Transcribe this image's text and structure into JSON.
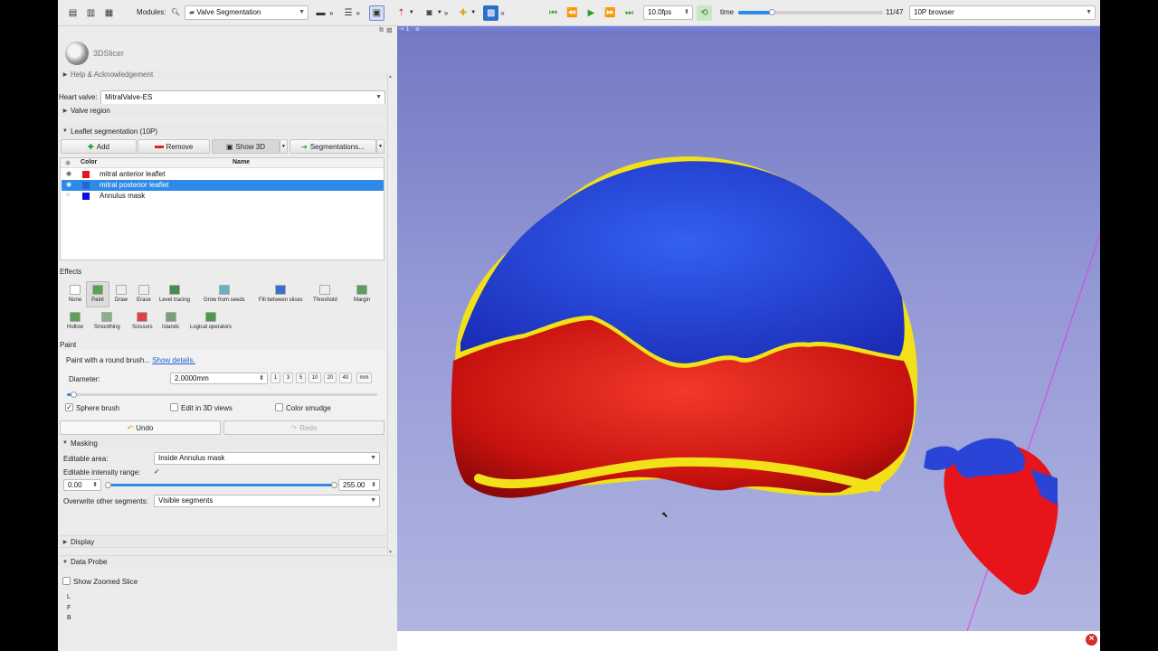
{
  "toolbar": {
    "modules_label": "Modules:",
    "module_selected": "Valve Segmentation",
    "fps_value": "10.0fps",
    "time_label": "time",
    "frame_value": "11/47",
    "browser_selected": "10P browser",
    "time_progress": 0.23
  },
  "app": {
    "name": "3DSlicer"
  },
  "panel": {
    "help_header": "Help & Acknowledgement",
    "heart_valve_label": "Heart valve:",
    "heart_valve_value": "MitralValve-ES",
    "valve_region_header": "Valve region",
    "leaflet_header": "Leaflet segmentation (10P)",
    "buttons": {
      "add": "Add",
      "remove": "Remove",
      "show3d": "Show 3D",
      "segmentations": "Segmentations..."
    },
    "columns": {
      "color": "Color",
      "name": "Name"
    },
    "segments": [
      {
        "name": "mitral anterior leaflet",
        "color": "#e8141b",
        "selected": false
      },
      {
        "name": "mitral posterior leaflet",
        "color": "#2a63d8",
        "selected": true
      },
      {
        "name": "Annulus mask",
        "color": "#1010e0",
        "selected": false
      }
    ],
    "effects_header": "Effects",
    "effects_row1": [
      "None",
      "Paint",
      "Draw",
      "Erase",
      "Level tracing",
      "Grow from seeds",
      "Fill between slices",
      "Threshold",
      "Margin"
    ],
    "effects_row2": [
      "Hollow",
      "Smoothing",
      "Scissors",
      "Islands",
      "Logical operators"
    ],
    "paint_header": "Paint",
    "paint_desc": "Paint with a round brush...",
    "show_details": "Show details.",
    "diameter_label": "Diameter:",
    "diameter_value": "2.0000mm",
    "diameter_presets": [
      "1",
      "3",
      "5",
      "10",
      "20",
      "40"
    ],
    "diameter_unit_btn": "mm",
    "sphere_brush": "Sphere brush",
    "edit_3d": "Edit in 3D views",
    "color_smudge": "Color smudge",
    "undo": "Undo",
    "redo": "Redo",
    "masking_header": "Masking",
    "editable_area_label": "Editable area:",
    "editable_area_value": "Inside Annulus mask",
    "intensity_label": "Editable intensity range:",
    "range_min": "0.00",
    "range_max": "255.00",
    "overwrite_label": "Overwrite other segments:",
    "overwrite_value": "Visible segments",
    "display_header": "Display",
    "data_probe_header": "Data Probe",
    "show_zoomed": "Show Zoomed Slice",
    "probe_letters": [
      "L",
      "F",
      "B"
    ]
  },
  "view": {
    "number": "1"
  },
  "colors": {
    "selection": "#2e8ae6",
    "anterior": "#e8141b",
    "posterior": "#2a44d8",
    "annulus": "#f2e018"
  }
}
